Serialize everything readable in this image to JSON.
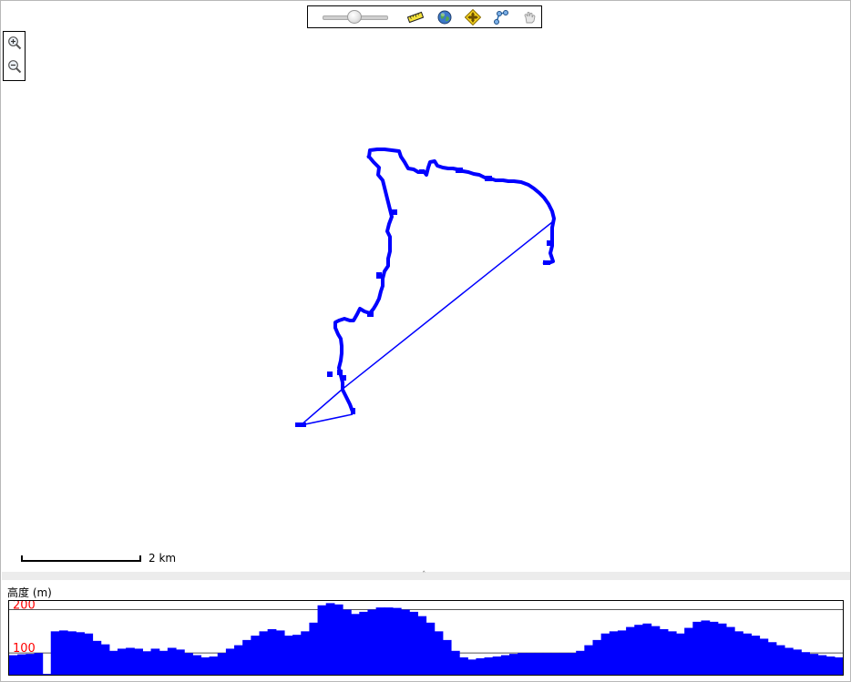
{
  "toolbar": {
    "zoom_level": 0.5,
    "icons": [
      "zoom-slider",
      "ruler-icon",
      "globe-icon",
      "pan-move-icon",
      "route-nodes-icon",
      "hand-pointer-icon"
    ]
  },
  "zoom_controls": {
    "icons": [
      "zoom-in-icon",
      "zoom-out-icon"
    ]
  },
  "map": {
    "track_color": "#0000ff",
    "scale_label": "2 km"
  },
  "elevation": {
    "label": "高度 (m)",
    "fill_color": "#0000ff",
    "tick_color": "#ff0000",
    "ticks": [
      "200",
      "100"
    ]
  },
  "chart_data": {
    "type": "area",
    "title": "",
    "ylabel": "高度 (m)",
    "ylim": [
      50,
      220
    ],
    "yticks": [
      100,
      200
    ],
    "values": [
      95,
      97,
      98,
      100,
      52,
      150,
      152,
      150,
      148,
      145,
      128,
      120,
      105,
      110,
      112,
      110,
      104,
      110,
      105,
      112,
      108,
      100,
      95,
      90,
      92,
      100,
      110,
      118,
      130,
      140,
      150,
      155,
      152,
      140,
      142,
      150,
      170,
      210,
      215,
      212,
      200,
      190,
      195,
      200,
      205,
      205,
      204,
      200,
      195,
      185,
      170,
      150,
      130,
      105,
      90,
      85,
      88,
      90,
      92,
      95,
      98,
      100,
      100,
      100,
      100,
      100,
      100,
      100,
      105,
      118,
      130,
      145,
      150,
      152,
      160,
      165,
      168,
      162,
      155,
      150,
      145,
      158,
      172,
      175,
      172,
      168,
      160,
      150,
      145,
      140,
      133,
      125,
      118,
      112,
      108,
      102,
      98,
      95,
      92,
      90
    ]
  }
}
